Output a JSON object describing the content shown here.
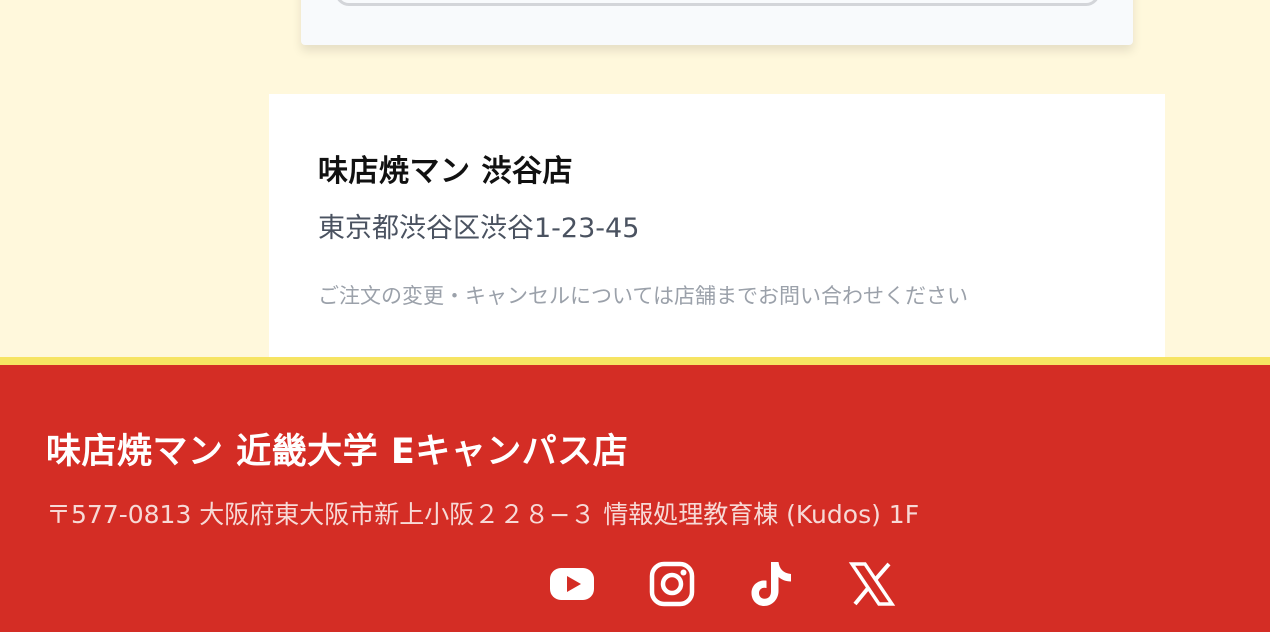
{
  "shop_card": {
    "name": "味店焼マン 渋谷店",
    "address": "東京都渋谷区渋谷1-23-45",
    "note": "ご注文の変更・キャンセルについては店舗までお問い合わせください"
  },
  "footer": {
    "title": "味店焼マン 近畿大学 Eキャンパス店",
    "address": "〒577-0813 大阪府東大阪市新上小阪２２８−３ 情報処理教育棟 (Kudos) 1F",
    "social": [
      {
        "name": "YouTube",
        "icon": "youtube-icon"
      },
      {
        "name": "Instagram",
        "icon": "instagram-icon"
      },
      {
        "name": "TikTok",
        "icon": "tiktok-icon"
      },
      {
        "name": "X",
        "icon": "x-icon"
      }
    ]
  },
  "colors": {
    "page_background": "#fff8dc",
    "footer_background": "#d42d25",
    "footer_accent": "#f6e463"
  }
}
